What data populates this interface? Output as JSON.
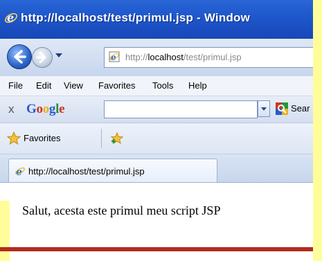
{
  "window": {
    "title": "http://localhost/test/primul.jsp - Window"
  },
  "address": {
    "url_prefix": "http://",
    "url_host": "localhost",
    "url_path": "/test/primul.jsp"
  },
  "menu": {
    "items": [
      "File",
      "Edit",
      "View",
      "Favorites",
      "Tools",
      "Help"
    ]
  },
  "google_toolbar": {
    "close": "x",
    "logo_letters": [
      "G",
      "o",
      "o",
      "g",
      "l",
      "e"
    ],
    "logo_colors": [
      "#2a59c9",
      "#d23324",
      "#e8b21c",
      "#2a59c9",
      "#23963a",
      "#d23324"
    ],
    "search_value": "",
    "search_label": "Sear"
  },
  "favorites": {
    "label": "Favorites"
  },
  "tab": {
    "label": "http://localhost/test/primul.jsp"
  },
  "content": {
    "text": "Salut, acesta este primul meu script JSP"
  },
  "colors": {
    "title_bar": "#1e58cc",
    "slide_background": "#fffd9a",
    "slide_stripe": "#b22a1e"
  }
}
